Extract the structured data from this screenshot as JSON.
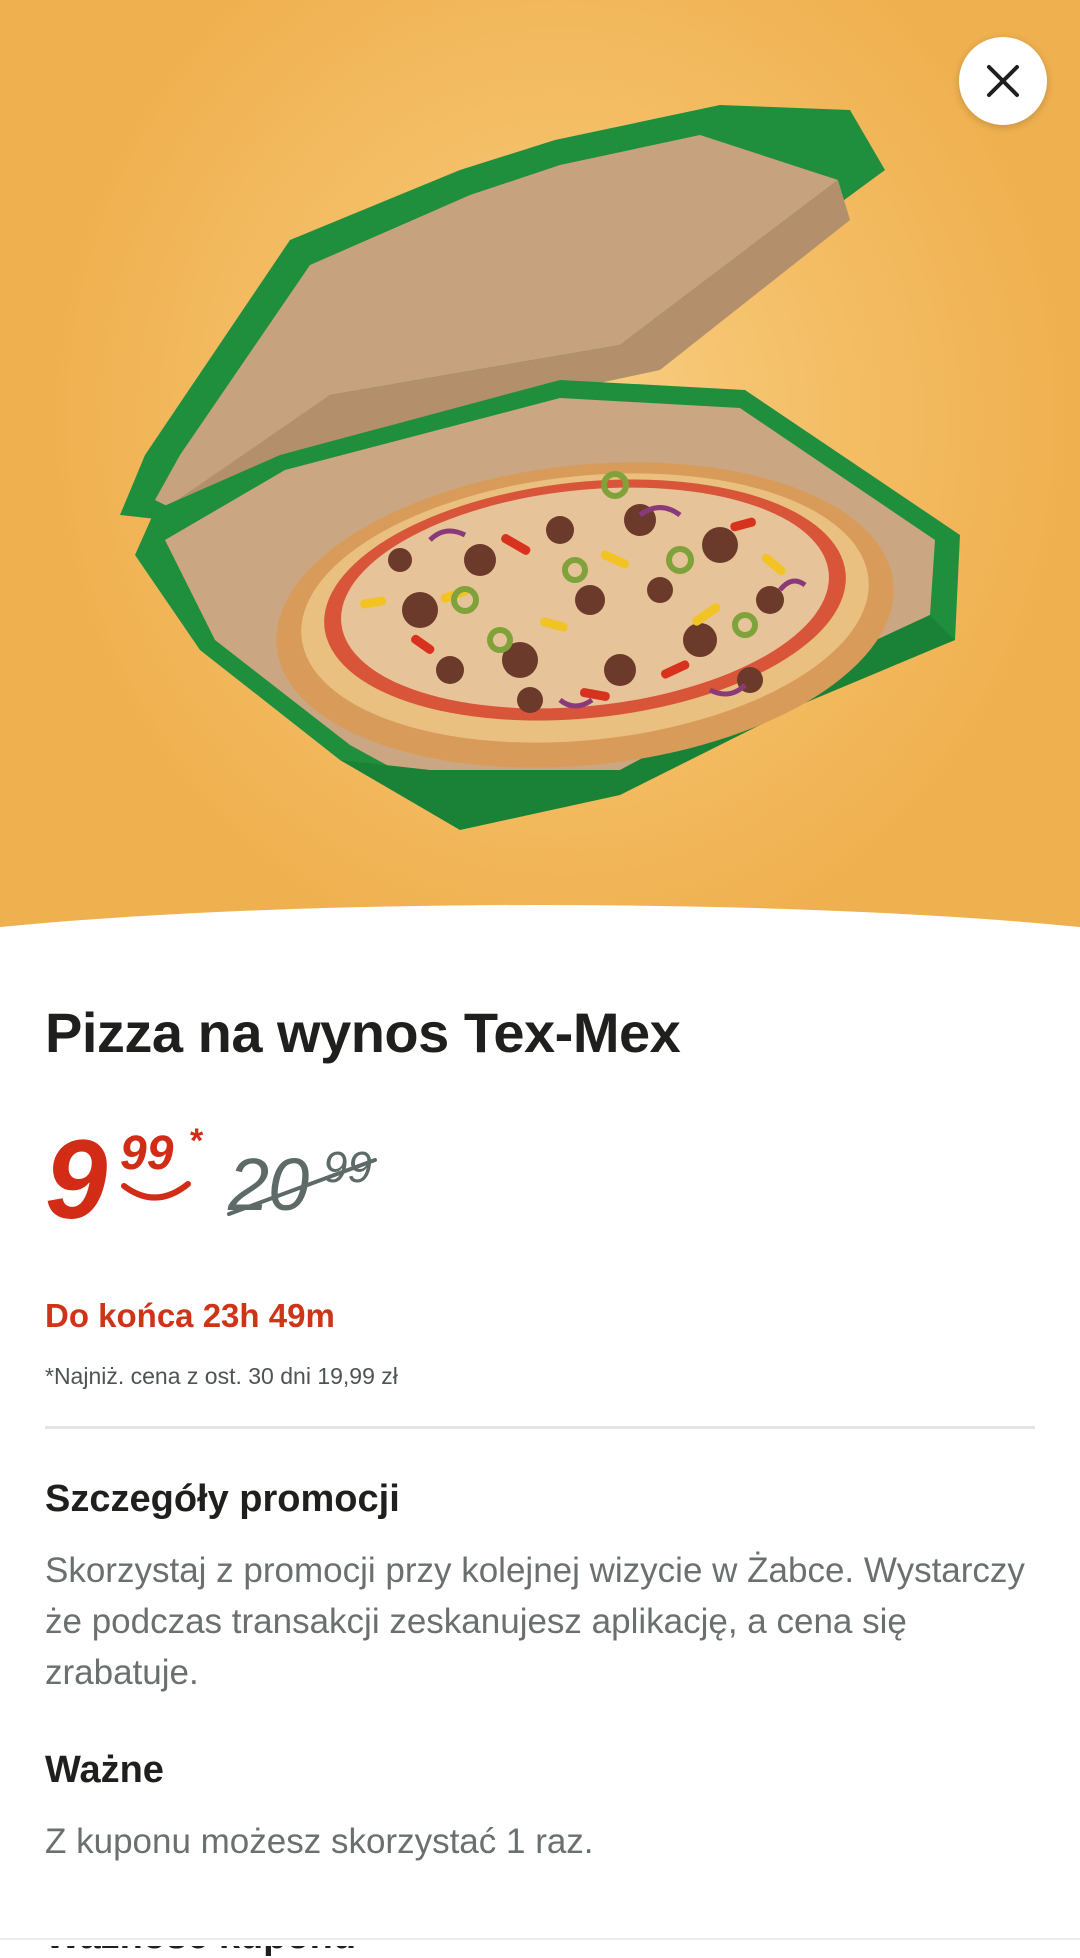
{
  "product": {
    "title": "Pizza na wynos Tex-Mex",
    "image_alt": "pizza-in-green-box"
  },
  "price": {
    "main": "9",
    "cents": "99",
    "asterisk": "*",
    "old_main": "20",
    "old_cents": "99"
  },
  "countdown": "Do końca 23h 49m",
  "lowest_price_note": "*Najniż. cena z ost. 30 dni 19,99 zł",
  "sections": {
    "details_heading": "Szczegóły promocji",
    "details_text": "Skorzystaj z promocji przy kolejnej wizycie w Żabce. Wystarczy że podczas transakcji zeskanujesz aplikację, a cena się zrabatuje.",
    "important_heading": "Ważne",
    "important_text": "Z kuponu możesz skorzystać 1 raz.",
    "validity_heading": "Ważność kuponu"
  },
  "colors": {
    "accent": "#d22c17",
    "hero_background": "#f4bd64",
    "box_green": "#1b8c3a"
  },
  "icons": {
    "close": "close-icon"
  }
}
